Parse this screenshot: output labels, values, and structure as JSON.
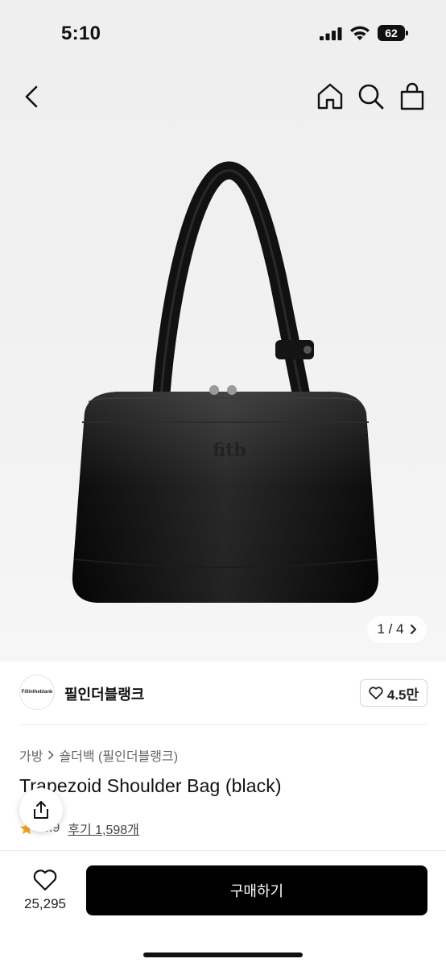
{
  "status_bar": {
    "time": "5:10",
    "battery": "62"
  },
  "nav": {
    "back_icon": "chevron-left-icon",
    "home_icon": "home-icon",
    "search_icon": "search-icon",
    "cart_icon": "shopping-bag-icon"
  },
  "gallery": {
    "pager": "1 / 4",
    "pager_icon": "chevron-right-icon"
  },
  "shop": {
    "avatar_text": "Fillintheblank",
    "name": "필인더블랭크",
    "likes": "4.5만"
  },
  "product": {
    "breadcrumb": [
      "가방",
      "숄더백 (필인더블랭크)"
    ],
    "title": "Trapezoid Shoulder Bag (black)",
    "rating": "4.9",
    "reviews": "후기 1,598개"
  },
  "bottom": {
    "wish_count": "25,295",
    "buy_label": "구매하기"
  },
  "colors": {
    "buy_button": "#000000",
    "star": "#f5a623",
    "hero_bg": "#efefef"
  }
}
